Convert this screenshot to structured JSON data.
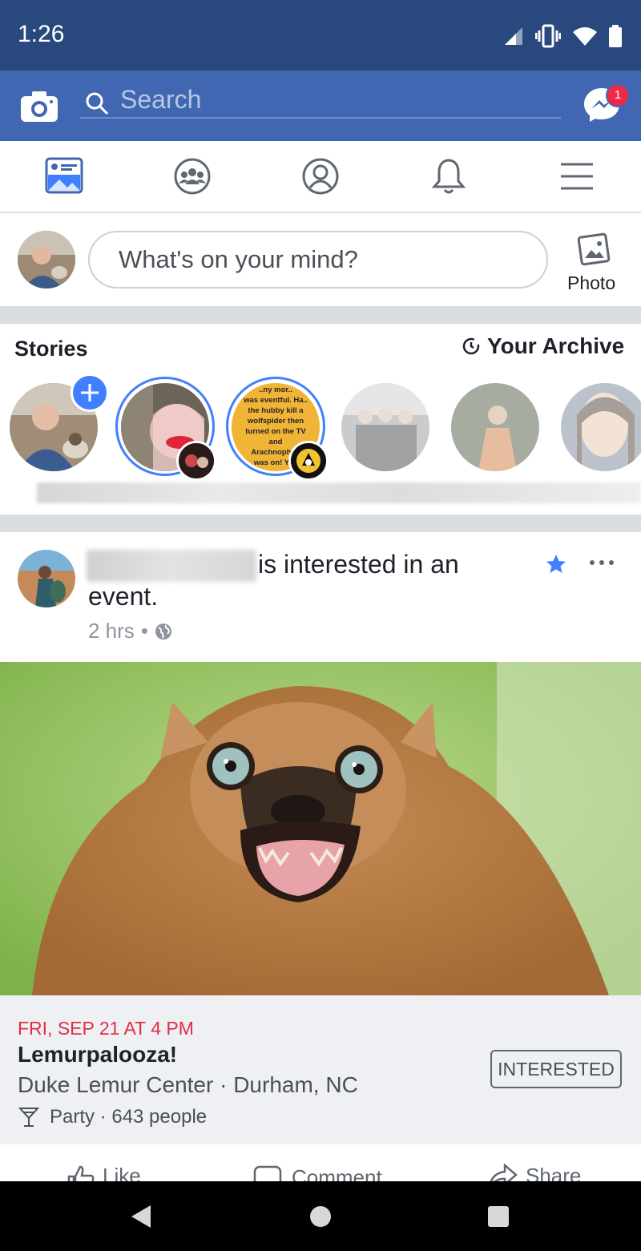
{
  "status_bar": {
    "time": "1:26"
  },
  "header": {
    "search_placeholder": "Search",
    "messenger_badge": "1"
  },
  "composer": {
    "prompt": "What's on your mind?",
    "photo_label": "Photo"
  },
  "stories": {
    "title": "Stories",
    "archive_label": "Your Archive",
    "story2_text": [
      "..ny mor..",
      "was eventful. Ha..",
      "the hubby kill a",
      "wolfspider then",
      "turned on the TV",
      "and",
      "Arachnopho..",
      "was on! Yay"
    ]
  },
  "post": {
    "action_text": "is interested in an",
    "action_text2": "event.",
    "time": "2 hrs",
    "event": {
      "date": "FRI, SEP 21 AT 4 PM",
      "title": "Lemurpalooza!",
      "location": "Duke Lemur Center · Durham, NC",
      "meta": "Party · 643 people",
      "interested_label": "INTERESTED"
    },
    "actions": {
      "like": "Like",
      "comment": "Comment",
      "share": "Share"
    }
  },
  "colors": {
    "brand_blue": "#4267b2",
    "status_blue": "#29487d",
    "accent": "#4080ff",
    "event_red": "#e42d45"
  }
}
